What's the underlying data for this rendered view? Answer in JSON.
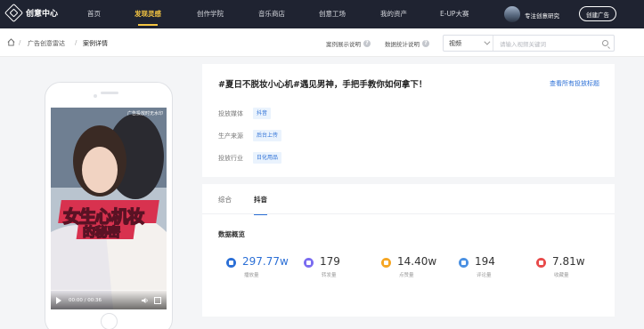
{
  "brand": {
    "name": "创意中心"
  },
  "nav": {
    "items": [
      "首页",
      "发现灵感",
      "创作学院",
      "音乐商店",
      "创意工场",
      "我的资产",
      "E-UP大赛"
    ],
    "active": "发现灵感"
  },
  "user": {
    "name": "专注创意研究"
  },
  "header": {
    "create_label": "创建广告"
  },
  "breadcrumb": {
    "items": [
      "广告创意雷达",
      "案例详情"
    ],
    "separator": "/"
  },
  "help": {
    "case_note": "案例展示说明",
    "stats_note": "数据统计说明"
  },
  "search": {
    "select_value": "视频",
    "placeholder": "请输入视频关键词"
  },
  "video": {
    "watermark": "广告投放时无水印",
    "overlay_line1": "女生心机妆",
    "overlay_line2": "的秘密",
    "time": "00:00 / 00:36"
  },
  "case": {
    "title": "#夏日不脱妆小心机#遇见男神，手把手教你如何拿下！",
    "view_all": "查看所有投放标题",
    "fields": [
      {
        "label": "投放媒体",
        "value": "抖音"
      },
      {
        "label": "生产来源",
        "value": "后台上传"
      },
      {
        "label": "投放行业",
        "value": "日化用品"
      }
    ]
  },
  "tabs": [
    "综合",
    "抖音"
  ],
  "active_tab": "抖音",
  "stats": {
    "title": "数据概览",
    "items": [
      {
        "value": "297.77w",
        "label": "播放量",
        "icon": "play-icon",
        "color": "#2b6fd6"
      },
      {
        "value": "179",
        "label": "转发量",
        "icon": "share-icon",
        "color": "#7a6cf0"
      },
      {
        "value": "14.40w",
        "label": "点赞量",
        "icon": "thumbs-up-icon",
        "color": "#f5a623"
      },
      {
        "value": "194",
        "label": "评论量",
        "icon": "comment-icon",
        "color": "#4a90e2"
      },
      {
        "value": "7.81w",
        "label": "收藏量",
        "icon": "star-icon",
        "color": "#e84a4a"
      }
    ]
  }
}
